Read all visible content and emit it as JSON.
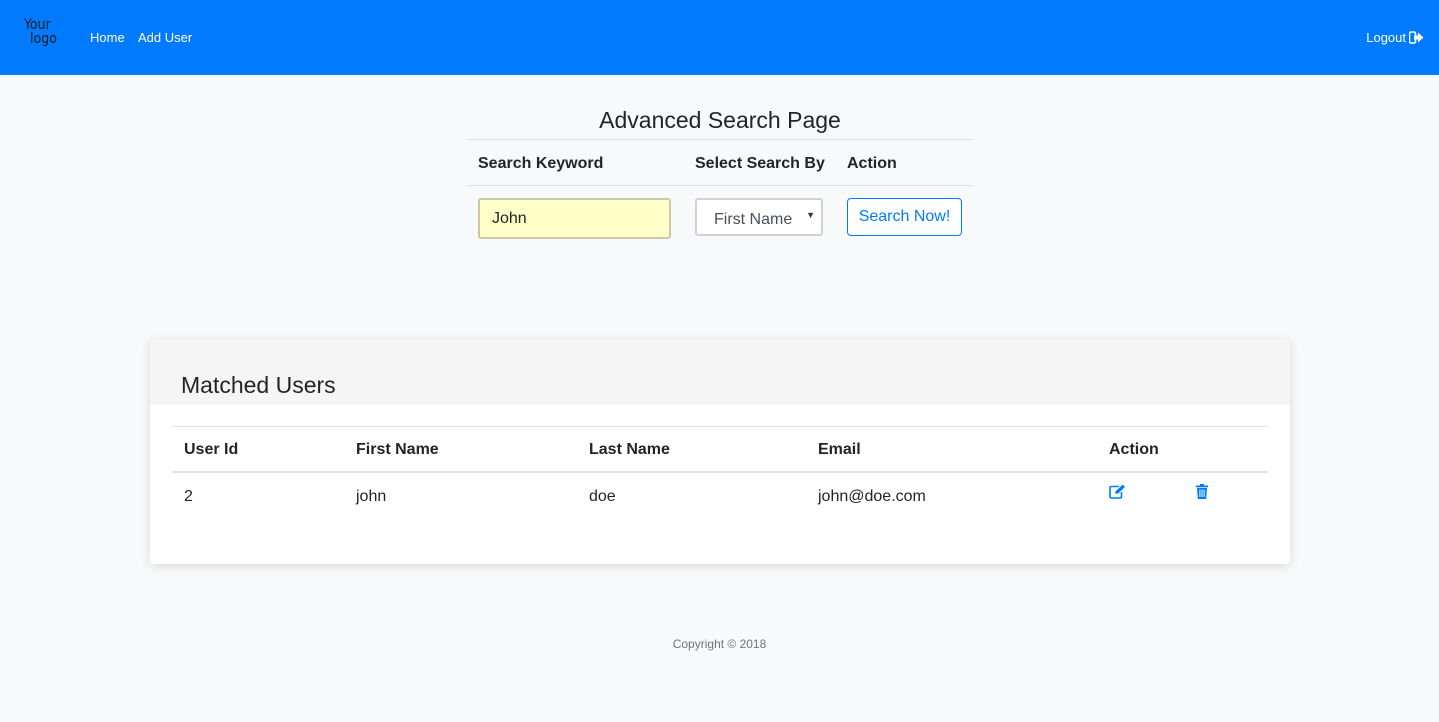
{
  "navbar": {
    "logo_line1": "Your",
    "logo_line2": "logo",
    "home_label": "Home",
    "add_user_label": "Add User",
    "logout_label": "Logout",
    "logout_icon": "sign-out-icon",
    "background_color": "#007bff"
  },
  "search": {
    "title": "Advanced Search Page",
    "headers": {
      "keyword": "Search Keyword",
      "search_by": "Select Search By",
      "action": "Action"
    },
    "keyword_value": "John",
    "search_by_selected": "First Name",
    "button_label": "Search Now!"
  },
  "results": {
    "title": "Matched Users",
    "columns": {
      "user_id": "User Id",
      "first_name": "First Name",
      "last_name": "Last Name",
      "email": "Email",
      "action": "Action"
    },
    "rows": [
      {
        "user_id": "2",
        "first_name": "john",
        "last_name": "doe",
        "email": "john@doe.com",
        "edit_icon": "edit-icon",
        "delete_icon": "trash-icon"
      }
    ]
  },
  "footer": {
    "copyright": "Copyright © 2018"
  },
  "colors": {
    "accent": "#007bff",
    "keyword_input_bg": "#ffffc8"
  }
}
